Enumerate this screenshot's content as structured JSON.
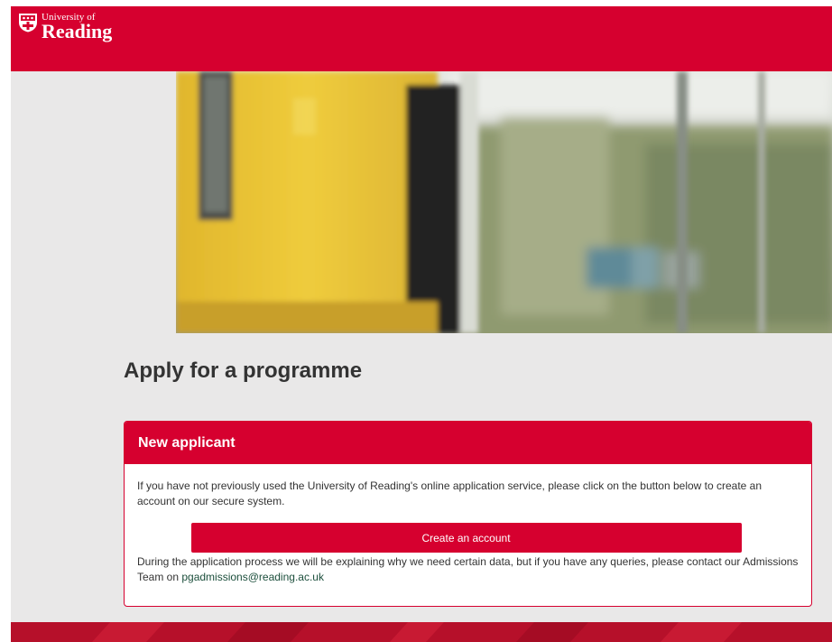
{
  "header": {
    "logo_line1": "University of",
    "logo_line2": "Reading"
  },
  "main": {
    "title": "Apply for a programme",
    "panel": {
      "title": "New applicant",
      "intro": "If you have not previously used the University of Reading's online application service, please click on the button below to create an account on our secure system.",
      "button_label": "Create an account",
      "note_text": "During the application process we will be explaining why we need certain data, but if you have any queries, please contact our Admissions Team on ",
      "email": "pgadmissions@reading.ac.uk"
    }
  },
  "colors": {
    "brand_red": "#d6002f",
    "page_background": "#e9e8e8",
    "link_green": "#1c4f3c"
  },
  "icons": [
    "university-crest-icon"
  ]
}
